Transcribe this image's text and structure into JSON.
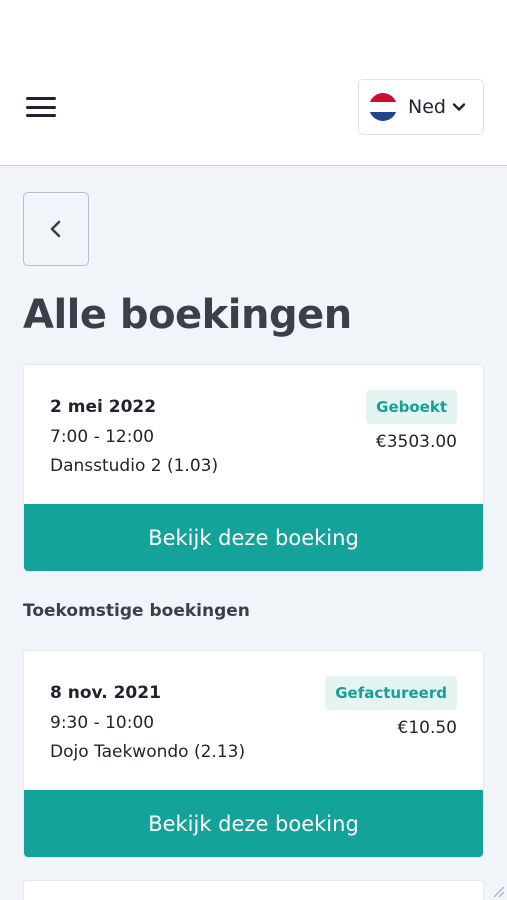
{
  "header": {
    "menu_icon": "hamburger-menu-icon",
    "language": {
      "label": "Ned",
      "flag_icon": "netherlands-flag-icon",
      "chevron_icon": "chevron-down-icon"
    }
  },
  "back_icon": "chevron-left-icon",
  "page_title": "Alle boekingen",
  "bookings": [
    {
      "date": "2 mei 2022",
      "time": "7:00 - 12:00",
      "room": "Dansstudio 2 (1.03)",
      "status": "Geboekt",
      "price": "€3503.00",
      "button_label": "Bekijk deze boeking"
    }
  ],
  "future_section": {
    "heading": "Toekomstige boekingen",
    "bookings": [
      {
        "date": "8 nov. 2021",
        "time": "9:30 - 10:00",
        "room": "Dojo Taekwondo (2.13)",
        "status": "Gefactureerd",
        "price": "€10.50",
        "button_label": "Bekijk deze boeking"
      }
    ]
  },
  "colors": {
    "accent": "#13a39a",
    "badge_bg": "#e3f4f3",
    "badge_text": "#16a097",
    "page_bg": "#f1f4f8"
  }
}
